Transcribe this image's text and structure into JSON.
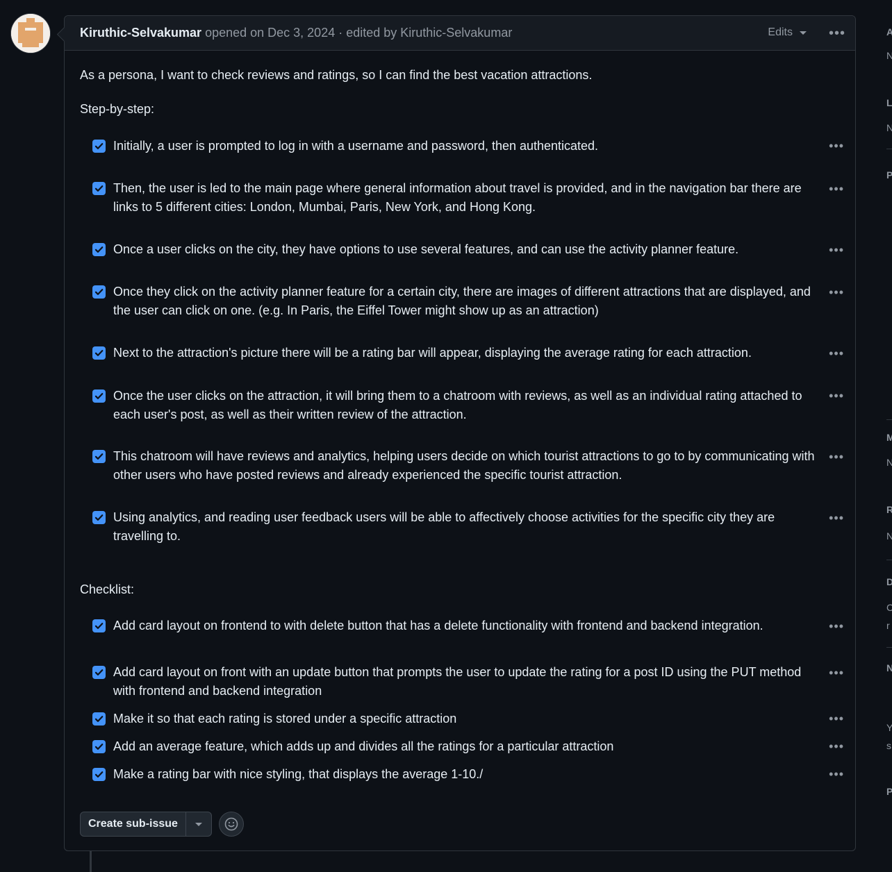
{
  "issue": {
    "author": "Kiruthic-Selvakumar",
    "meta": "opened on Dec 3, 2024 · edited by Kiruthic-Selvakumar",
    "edits_label": "Edits",
    "intro": "As a persona, I want to check reviews and ratings, so I can find the best vacation attractions.",
    "steps_heading": "Step-by-step:",
    "steps": [
      "Initially, a user is prompted to log in with a username and password, then authenticated.",
      "Then, the user is led to the main page where general information about travel is provided, and in the navigation bar there are links to 5 different cities: London, Mumbai, Paris, New York, and Hong Kong.",
      "Once a user clicks on the city, they have options to use several features, and can use the activity planner feature.",
      "Once they click on the activity planner feature for a certain city, there are images of different attractions that are displayed, and the user can click on one. (e.g. In Paris, the Eiffel Tower might show up as an attraction)",
      "Next to the attraction's picture there will be a rating bar will appear, displaying the average rating for each attraction.",
      "Once the user clicks on the attraction, it will bring them to a chatroom with reviews, as well as an individual rating attached to each user's post, as well as their written review of the attraction.",
      "This chatroom will have reviews and analytics, helping users decide on which tourist attractions to go to by communicating with other users who have posted reviews and already experienced the specific tourist attraction.",
      "Using analytics, and reading user feedback users will be able to affectively choose activities for the specific city they are travelling to."
    ],
    "checklist_heading": "Checklist:",
    "checklist": [
      "Add card layout on frontend to with delete button that has a delete functionality with frontend and backend integration.",
      "Add card layout on front with an update button that prompts the user to update the rating for a post ID using the PUT method with frontend and backend integration",
      "Make it so that each rating is stored under a specific attraction",
      "Add an average feature, which adds up and divides all the ratings for a particular attraction",
      "Make a rating bar with nice styling, that displays the average 1-10./"
    ],
    "create_sub_issue_label": "Create sub-issue"
  },
  "sidebar_letters": [
    "A",
    "N",
    "L",
    "N",
    "P",
    "M",
    "N",
    "R",
    "N",
    "D",
    "C",
    "r",
    "N",
    "Y",
    "s",
    "P"
  ],
  "colors": {
    "checkbox": "#4493f8",
    "background": "#0d1117",
    "header": "#161b22"
  },
  "icons": [
    "kebab-icon",
    "caret-down-icon",
    "check-icon",
    "smiley-icon",
    "avatar-identicon"
  ]
}
